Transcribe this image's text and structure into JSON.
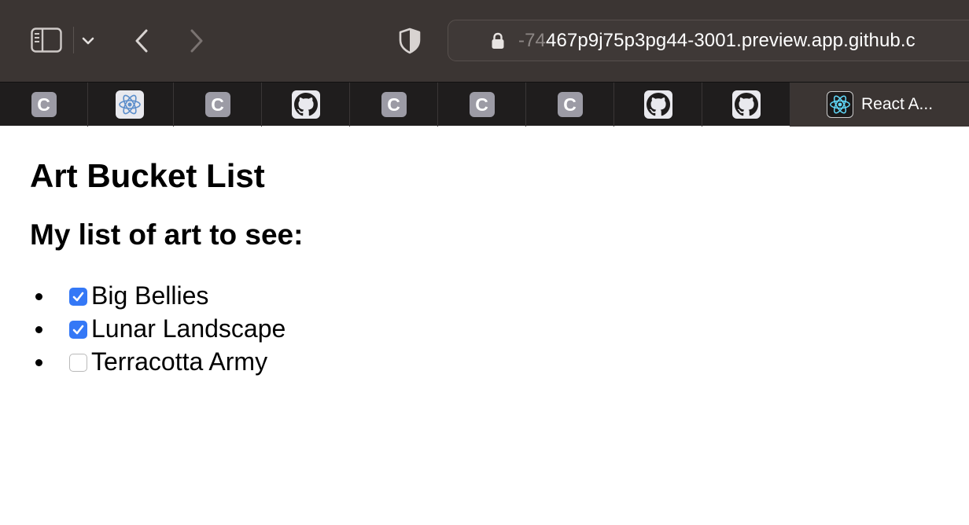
{
  "browser": {
    "toolbar": {
      "url_faded": "-74",
      "url_main": "467p9j75p3pg44-3001.preview.app.github.c"
    },
    "tabs": [
      {
        "favicon": "c-letter-icon",
        "letter": "C"
      },
      {
        "favicon": "react-icon"
      },
      {
        "favicon": "c-letter-icon",
        "letter": "C"
      },
      {
        "favicon": "github-icon"
      },
      {
        "favicon": "c-letter-icon",
        "letter": "C"
      },
      {
        "favicon": "c-letter-icon",
        "letter": "C"
      },
      {
        "favicon": "c-letter-icon",
        "letter": "C"
      },
      {
        "favicon": "github-icon"
      },
      {
        "favicon": "github-icon"
      }
    ],
    "active_tab": {
      "favicon": "react-icon",
      "label": "React A..."
    }
  },
  "page": {
    "title": "Art Bucket List",
    "subtitle": "My list of art to see:",
    "items": [
      {
        "label": "Big Bellies",
        "checked": true
      },
      {
        "label": "Lunar Landscape",
        "checked": true
      },
      {
        "label": "Terracotta Army",
        "checked": false
      }
    ]
  },
  "colors": {
    "toolbar_bg": "#3b3533",
    "tabstrip_bg": "#1f1d1d",
    "checkbox_accent": "#3478f6"
  }
}
